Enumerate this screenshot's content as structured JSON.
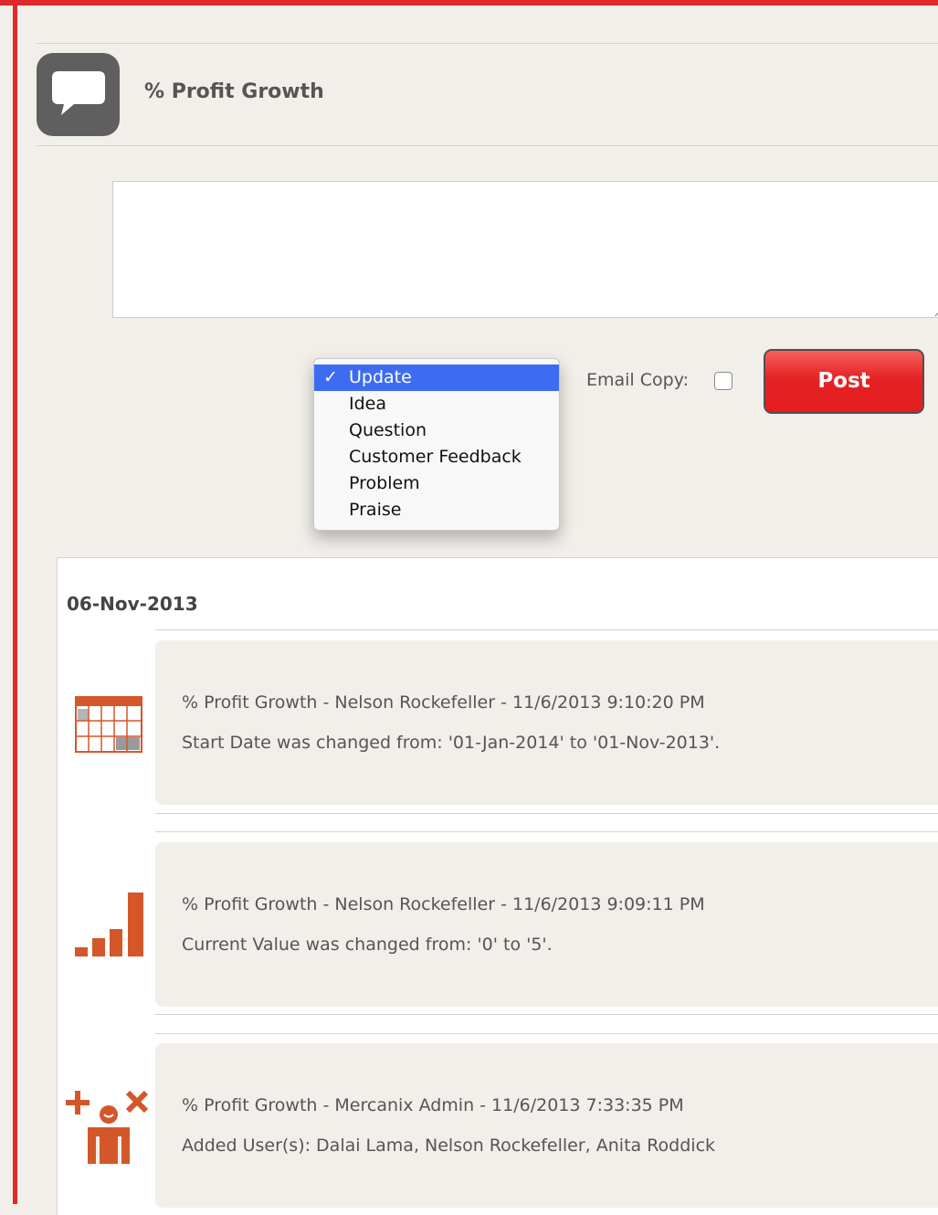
{
  "page": {
    "title": "% Profit Growth"
  },
  "composer": {
    "textarea_value": "",
    "type_options": [
      "Update",
      "Idea",
      "Question",
      "Customer Feedback",
      "Problem",
      "Praise"
    ],
    "selected_type": "Update",
    "check_mark": "✓",
    "email_copy_label": "Email Copy:",
    "email_copy_checked": false,
    "post_label": "Post"
  },
  "feed": {
    "date": "06-Nov-2013",
    "items": [
      {
        "icon": "calendar-icon",
        "header": "% Profit Growth - Nelson Rockefeller - 11/6/2013 9:10:20 PM",
        "detail": "Start Date was changed from: '01-Jan-2014' to '01-Nov-2013'."
      },
      {
        "icon": "bar-chart-icon",
        "header": "% Profit Growth - Nelson Rockefeller - 11/6/2013 9:09:11 PM",
        "detail": "Current Value was changed from: '0' to '5'."
      },
      {
        "icon": "add-remove-user-icon",
        "header": "% Profit Growth - Mercanix Admin - 11/6/2013 7:33:35 PM",
        "detail": "Added User(s): Dalai Lama, Nelson Rockefeller, Anita Roddick"
      }
    ]
  },
  "colors": {
    "accent_red": "#e52224",
    "icon_orange": "#d4572a",
    "selection_blue": "#3d6cf2"
  }
}
